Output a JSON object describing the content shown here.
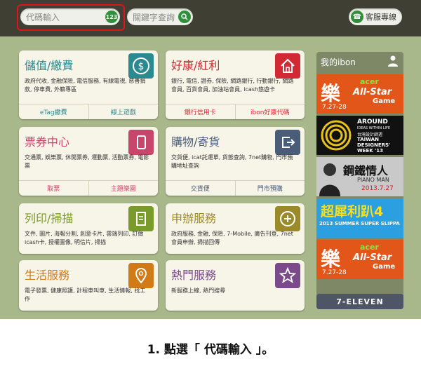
{
  "search": {
    "code_placeholder": "代碼輸入",
    "code_badge": "123",
    "keyword_placeholder": "關鍵字查詢"
  },
  "header": {
    "service_label": "客服專線"
  },
  "cards": [
    {
      "title": "儲值/繳費",
      "color": "#2a8a8f",
      "icon": "dollar-icon",
      "desc": "政府代收, 金融保險, 電信服務, 有線電視, 慈善捐款, 停車費, 外籍專區",
      "links": [
        "eTag繳費",
        "線上遊戲"
      ],
      "link_color": "#2a8a8f"
    },
    {
      "title": "好康/紅利",
      "color": "#d12a35",
      "icon": "home-icon",
      "desc": "銀行, 電信, 證券, 保險, 網路銀行, 行動銀行, 網路會員, 百貨會員, 加油站會員, icash悠遊卡",
      "links": [
        "銀行信用卡",
        "ibon好康代碼"
      ],
      "link_color": "#d12a35"
    },
    {
      "title": "票券中心",
      "color": "#c8456c",
      "icon": "phone-icon",
      "desc": "交通票, 娛樂票, 休閒票券, 運動票, 活動票券, 電影票",
      "links": [
        "取票",
        "主題樂園"
      ],
      "link_color": "#c8456c"
    },
    {
      "title": "購物/寄貨",
      "color": "#4a5d78",
      "icon": "share-icon",
      "desc": "交貨便, icat託運單, 貨態查詢, 7net購物, 門市預購地址查詢",
      "links": [
        "交貨便",
        "門市預購"
      ],
      "link_color": "#4a5d78"
    },
    {
      "title": "列印/掃描",
      "color": "#7a9a2a",
      "icon": "document-icon",
      "desc": "文件, 圖片, 海報分割, 創意卡片, 雲端列印, 訂做icash卡, 授權圖像, 明信片, 掃描",
      "links": [],
      "link_color": "#7a9a2a"
    },
    {
      "title": "申辦服務",
      "color": "#9a8a2a",
      "icon": "plus-icon",
      "desc": "政府服務, 金融, 保險, 7-Mobile, 廣告刊登, 7net會員申辦, 掃描回傳",
      "links": [],
      "link_color": "#9a8a2a"
    },
    {
      "title": "生活服務",
      "color": "#d07a18",
      "icon": "location-icon",
      "desc": "電子發票, 健康照護, 計程車叫車, 生活情報, 找工作",
      "links": [],
      "link_color": "#d07a18"
    },
    {
      "title": "熱門服務",
      "color": "#7a4a8a",
      "icon": "star-icon",
      "desc": "新服務上線, 熱門搜尋",
      "links": [],
      "link_color": "#7a4a8a"
    }
  ],
  "sidebar": {
    "title": "我的ibon",
    "banners": [
      {
        "big": "樂",
        "right1": "acer",
        "right2": "All-Star",
        "right3": "Game",
        "date": "7.27-28"
      },
      {
        "big": "AROUND",
        "line2": "IDEAS WITHIN LIFE",
        "line3": "台灣設計師週",
        "line4": "TAIWAN",
        "line5": "DESIGNERS'",
        "line6": "WEEK '13"
      },
      {
        "big": "鋼鐵情人",
        "line2": "PIANO MAN",
        "date": "2013.7.27"
      },
      {
        "big": "超犀利趴4",
        "line2": "2013 SUMMER SUPER SLIPPA"
      },
      {
        "big": "樂",
        "right1": "acer",
        "right2": "All-Star",
        "right3": "Game",
        "date": "7.27-28"
      }
    ],
    "footer": "7-ELEVEN"
  },
  "caption": "1. 點選「 代碼輸入 」。"
}
